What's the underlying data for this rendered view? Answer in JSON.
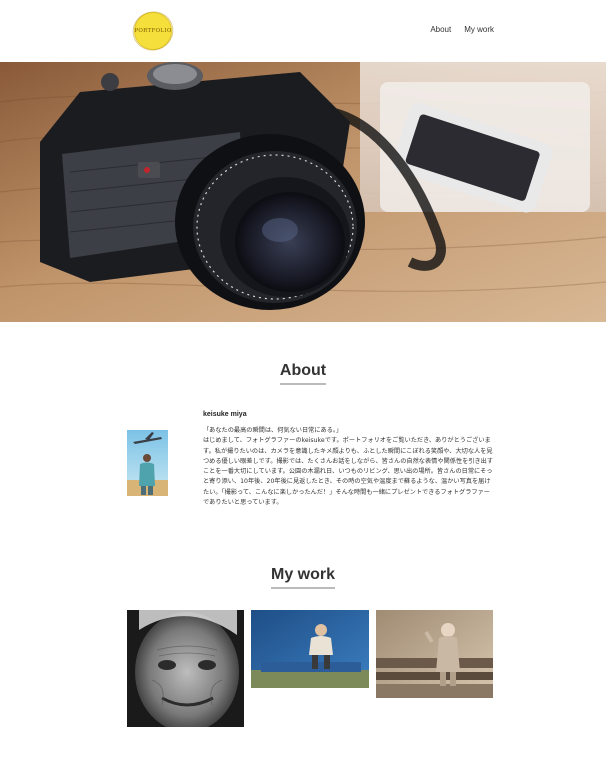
{
  "header": {
    "logo_text": "PORTFOLIO",
    "nav": [
      {
        "label": "About"
      },
      {
        "label": "My work"
      }
    ]
  },
  "about": {
    "title": "About",
    "name": "keisuke miya",
    "text": "「あなたの最高の瞬間は、何気ない日常にある。」\nはじめまして、フォトグラファーのkeisukeです。ポートフォリオをご覧いただき、ありがとうございます。私が撮りたいのは、カメラを意識したキメ顔よりも、ふとした瞬間にこぼれる笑顔や、大切な人を見つめる優しい眼差しです。撮影では、たくさんお話をしながら、皆さんの自然な表情や関係性を引き出すことを一番大切にしています。公園の木漏れ日、いつものリビング、思い出の場所。皆さんの日常にそっと寄り添い、10年後、20年後に見返したとき、その時の空気や温度まで蘇るような、温かい写真を届けたい。「撮影って、こんなに楽しかったんだ！」そんな時間も一緒にプレゼントできるフォトグラファーでありたいと思っています。"
  },
  "works": {
    "title": "My work"
  },
  "colors": {
    "logo": "#f5df3b",
    "title_underline": "#bbbbbb"
  }
}
